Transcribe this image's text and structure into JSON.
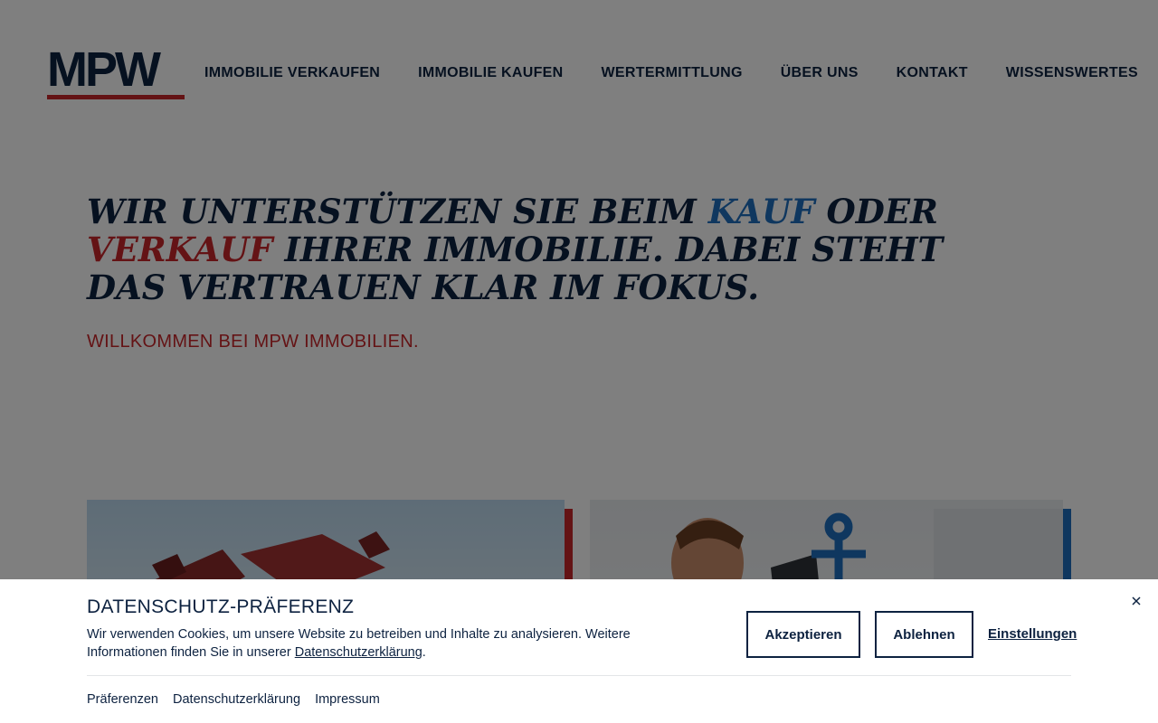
{
  "header": {
    "logo_text": "MPW",
    "nav": [
      "IMMOBILIE VERKAUFEN",
      "IMMOBILIE KAUFEN",
      "WERTERMITTLUNG",
      "ÜBER UNS",
      "KONTAKT",
      "WISSENSWERTES"
    ]
  },
  "hero": {
    "title_part1": "WIR UNTERSTÜTZEN SIE BEIM ",
    "title_highlight_kauf": "KAUF",
    "title_part2": " ODER ",
    "title_highlight_verkauf": "VERKAUF",
    "title_part3": " IHRER IMMOBILIE. DABEI STEHT DAS VERTRAUEN KLAR IM FOKUS.",
    "subtitle": "WILLKOMMEN BEI MPW IMMOBILIEN."
  },
  "cookie_banner": {
    "title": "DATENSCHUTZ-PRÄFERENZ",
    "text_before_link": "Wir verwenden Cookies, um unsere Website zu betreiben und Inhalte zu analysieren. Weitere Informationen finden Sie in unserer ",
    "link_label": "Datenschutzerklärung",
    "text_after_link": ".",
    "accept_label": "Akzeptieren",
    "decline_label": "Ablehnen",
    "settings_label": "Einstellungen",
    "footer_links": [
      "Präferenzen",
      "Datenschutzerklärung",
      "Impressum"
    ]
  },
  "colors": {
    "navy": "#0d2240",
    "red": "#c8262b",
    "blue": "#1e6fbf"
  }
}
